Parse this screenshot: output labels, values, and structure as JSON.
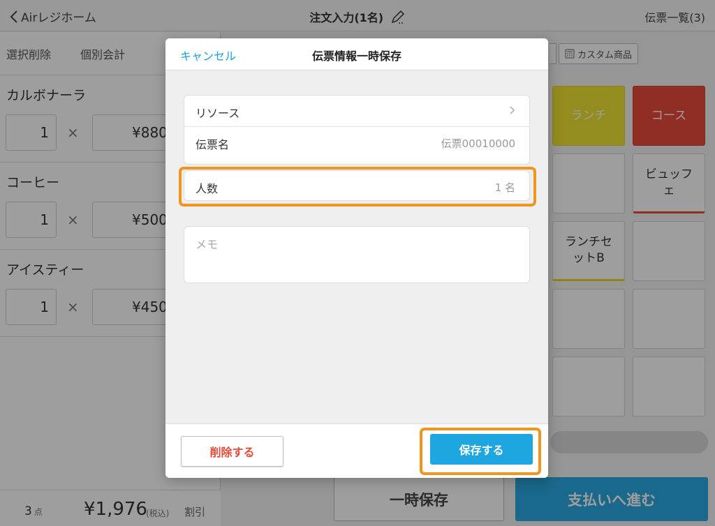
{
  "app": {
    "back_label": "Airレジホーム",
    "title": "注文入力(1名)",
    "slip_list": "伝票一覧(3)"
  },
  "left": {
    "actions": [
      "選択削除",
      "個別会計"
    ],
    "items": [
      {
        "name": "カルボナーラ",
        "qty": "1",
        "price": "¥880"
      },
      {
        "name": "コーヒー",
        "qty": "1",
        "price": "¥500"
      },
      {
        "name": "アイスティー",
        "qty": "1",
        "price": "¥450"
      }
    ],
    "times": "×",
    "footer": {
      "count": "3",
      "count_unit": "点",
      "total": "¥1,976",
      "tax": "(税込)",
      "discount": "割引"
    }
  },
  "right": {
    "custom_product": "カスタム商品",
    "tiles": [
      "ランチ",
      "コース",
      "ビュッフェ",
      "ランチセットB"
    ],
    "hold_button": "一時保存",
    "pay_button": "支払いへ進む"
  },
  "modal": {
    "cancel": "キャンセル",
    "title": "伝票情報一時保存",
    "resource_label": "リソース",
    "slip_name_label": "伝票名",
    "slip_name_value": "伝票00010000",
    "guests_label": "人数",
    "guests_value": "1 名",
    "memo_placeholder": "メモ",
    "delete_button": "削除する",
    "save_button": "保存する"
  },
  "colors": {
    "accent": "#1ea6e0",
    "danger": "#e84a3a",
    "highlight": "#f0961e",
    "yellow_tile": "#f1e232",
    "red_tile": "#e94a3b"
  }
}
